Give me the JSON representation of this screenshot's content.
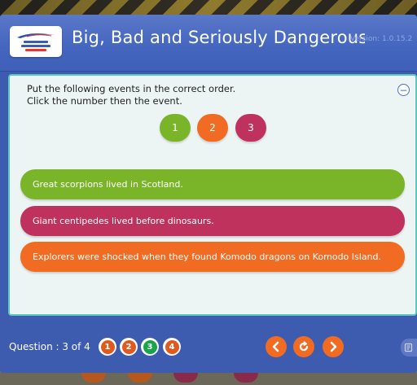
{
  "header": {
    "title": "Big, Bad and Seriously Dangerous C...",
    "version": "Version: 1.0.15.2",
    "logo_text": "Making Waves"
  },
  "panel": {
    "instruction_line1": "Put the following events in the correct order.",
    "instruction_line2": "Click the number then the event.",
    "collapse_icon": "minus-circle-icon",
    "numbers": [
      {
        "label": "1",
        "color": "#7ab529"
      },
      {
        "label": "2",
        "color": "#f26b22"
      },
      {
        "label": "3",
        "color": "#c0325e"
      }
    ],
    "events": [
      {
        "text": "Great scorpions lived in Scotland.",
        "color": "#7ab529"
      },
      {
        "text": "Giant centipedes lived before dinosaurs.",
        "color": "#c0325e"
      },
      {
        "text": "Explorers were shocked when they found Komodo dragons on Komodo Island.",
        "color": "#f26b22"
      }
    ]
  },
  "footer": {
    "question_label": "Question : 3 of 4",
    "questions": [
      {
        "label": "1",
        "color": "#e05a20"
      },
      {
        "label": "2",
        "color": "#e05a20"
      },
      {
        "label": "3",
        "color": "#1aa34a"
      },
      {
        "label": "4",
        "color": "#e05a20"
      }
    ],
    "nav": {
      "prev_icon": "chevron-left-icon",
      "reload_icon": "refresh-icon",
      "next_icon": "chevron-right-icon"
    },
    "side_icon": "notes-icon"
  },
  "colors": {
    "app_blue": "#3d5cb0",
    "panel_bg": "#ecf5f4",
    "panel_border": "#58c8bf"
  }
}
